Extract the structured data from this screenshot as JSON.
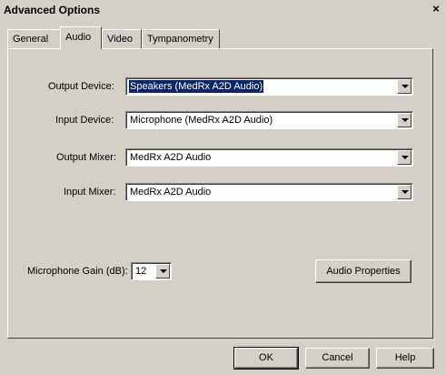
{
  "window": {
    "title": "Advanced Options",
    "close_glyph": "×"
  },
  "tabs": [
    {
      "label": "General"
    },
    {
      "label": "Audio"
    },
    {
      "label": "Video"
    },
    {
      "label": "Tympanometry"
    }
  ],
  "active_tab": "Audio",
  "audio": {
    "output_device": {
      "label": "Output Device:",
      "value": "Speakers (MedRx A2D Audio)"
    },
    "input_device": {
      "label": "Input Device:",
      "value": "Microphone (MedRx A2D Audio)"
    },
    "output_mixer": {
      "label": "Output Mixer:",
      "value": "MedRx A2D Audio"
    },
    "input_mixer": {
      "label": "Input Mixer:",
      "value": "MedRx A2D Audio"
    },
    "mic_gain": {
      "label": "Microphone Gain (dB):",
      "value": "12"
    },
    "audio_properties_label": "Audio Properties"
  },
  "buttons": {
    "ok": "OK",
    "cancel": "Cancel",
    "help": "Help"
  },
  "icons": {
    "dropdown": "chevron-down-icon",
    "close": "close-icon"
  },
  "colors": {
    "face": "#d4d0c8",
    "selection": "#0a246a",
    "field": "#ffffff"
  }
}
